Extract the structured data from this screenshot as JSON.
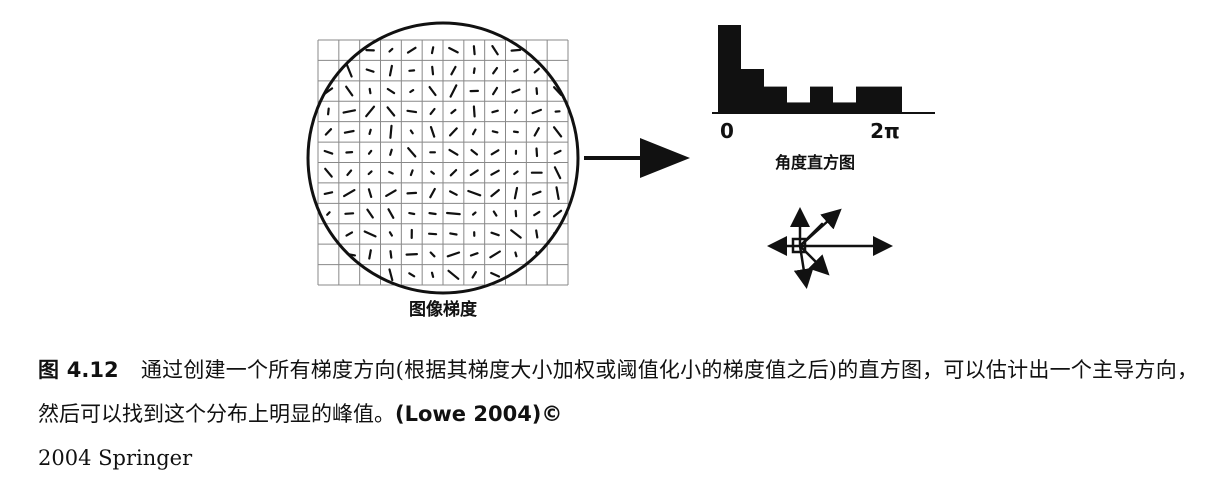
{
  "figure": {
    "gradient_label": "图像梯度",
    "histogram_label": "角度直方图",
    "axis_start": "0",
    "axis_end": "2π",
    "histogram_bins": [
      1.0,
      0.5,
      0.3,
      0.12,
      0.3,
      0.12,
      0.3,
      0.3
    ]
  },
  "caption": {
    "label": "图 4.12",
    "text": "通过创建一个所有梯度方向(根据其梯度大小加权或阈值化小的梯度值之后)的直方图，可以估计出一个主导方向，然后可以找到这个分布上明显的峰值。",
    "citation": "(Lowe 2004)©",
    "copyright": "2004 Springer"
  }
}
